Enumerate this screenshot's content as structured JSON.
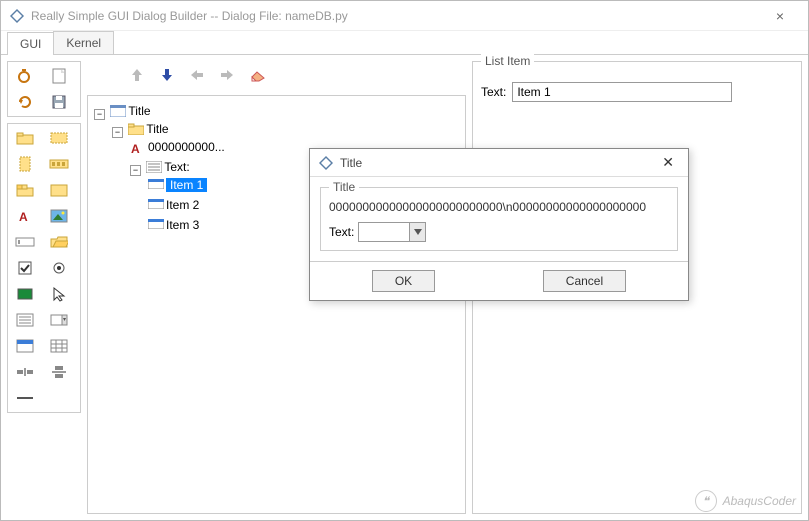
{
  "window": {
    "title": "Really Simple GUI Dialog Builder -- Dialog File: nameDB.py"
  },
  "tabs": [
    {
      "label": "GUI",
      "active": true
    },
    {
      "label": "Kernel",
      "active": false
    }
  ],
  "tree": {
    "root": "Title",
    "folder": "Title",
    "text_node": "0000000000...",
    "text_group": "Text:",
    "items": [
      "Item 1",
      "Item 2",
      "Item 3"
    ],
    "selected_index": 0
  },
  "property_panel": {
    "legend": "List Item",
    "text_label": "Text:",
    "text_value": "Item 1"
  },
  "modal": {
    "title": "Title",
    "group_legend": "Title",
    "content": "00000000000000000000000000\\n00000000000000000000",
    "text_label": "Text:",
    "text_value": "",
    "ok": "OK",
    "cancel": "Cancel"
  },
  "watermark": "AbaqusCoder"
}
